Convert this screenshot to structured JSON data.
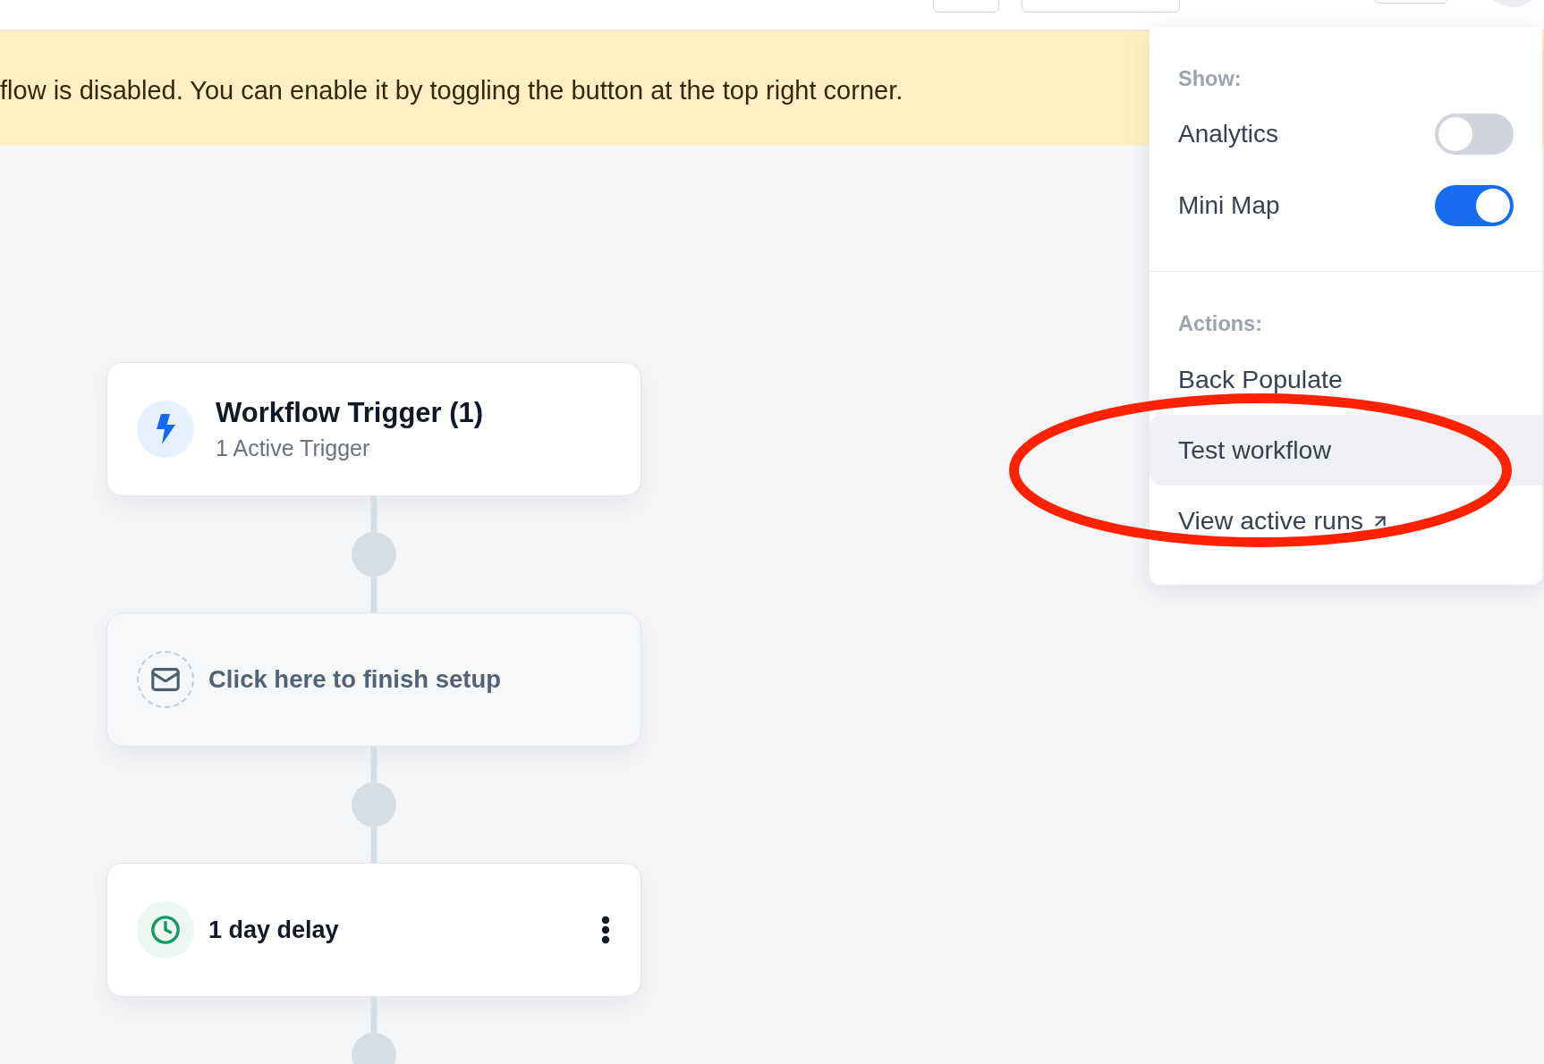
{
  "banner": {
    "text": "flow is disabled. You can enable it by toggling the button at the top right corner."
  },
  "nodes": [
    {
      "kind": "trigger",
      "title": "Workflow Trigger (1)",
      "subtitle": "1 Active Trigger"
    },
    {
      "kind": "setup",
      "title": "Click here to finish setup"
    },
    {
      "kind": "delay",
      "title": "1 day delay"
    }
  ],
  "menu": {
    "show": {
      "label": "Show:",
      "toggles": [
        {
          "label": "Analytics",
          "on": false
        },
        {
          "label": "Mini Map",
          "on": true
        }
      ]
    },
    "actions": {
      "label": "Actions:",
      "items": [
        {
          "kind": "action",
          "label": "Back Populate",
          "highlighted": false,
          "circled": false
        },
        {
          "kind": "action",
          "label": "Test workflow",
          "highlighted": true,
          "circled": true
        },
        {
          "kind": "external_link",
          "label": "View active runs",
          "highlighted": false,
          "circled": false
        }
      ]
    }
  }
}
